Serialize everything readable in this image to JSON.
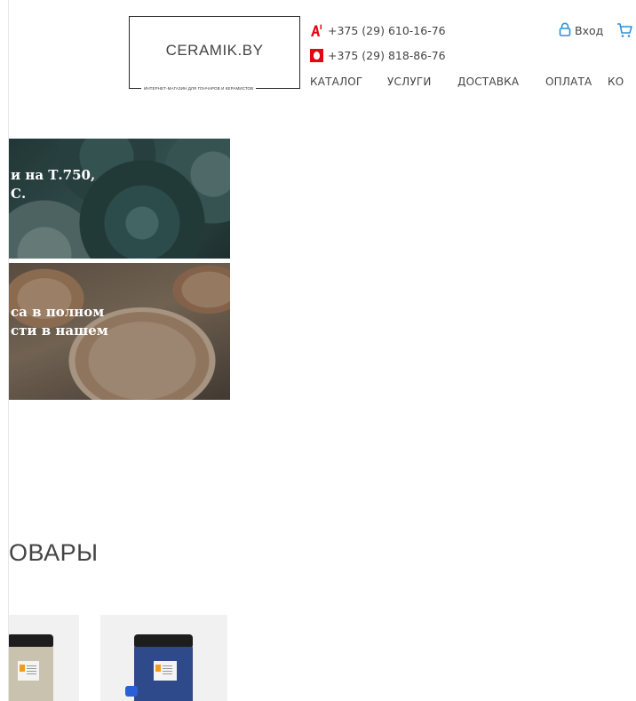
{
  "header": {
    "logo": {
      "title": "CERAMIK.BY",
      "subtitle": "ИНТЕРНЕТ-МАГАЗИН ДЛЯ ГОНЧАРОВ И КЕРАМИСТОВ"
    },
    "phones": [
      {
        "operator_icon": "a1-logo-icon",
        "number": "+375 (29) 610-16-76"
      },
      {
        "operator_icon": "mts-logo-icon",
        "number": "+375 (29) 818-86-76"
      }
    ],
    "login_label": "Вход",
    "nav": [
      "КАТАЛОГ",
      "УСЛУГИ",
      "ДОСТАВКА",
      "ОПЛАТА",
      "КО"
    ]
  },
  "banners": [
    {
      "text": "и на Т.750,\nС."
    },
    {
      "text": "са в полном\nсти в нашем"
    }
  ],
  "section": {
    "title": "ОВАРЫ"
  },
  "colors": {
    "accent": "#2f8fd6",
    "mts_red": "#e30613",
    "a1_red": "#e30613"
  }
}
